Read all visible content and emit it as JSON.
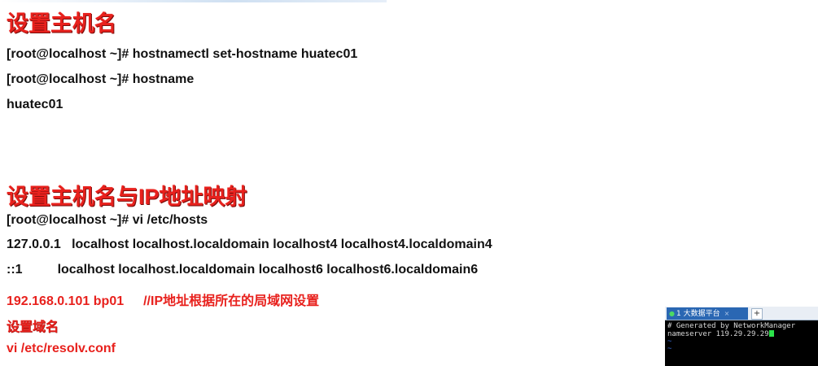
{
  "section1": {
    "heading": "设置主机名",
    "lines": [
      "[root@localhost ~]# hostnamectl set-hostname huatec01",
      "[root@localhost ~]# hostname",
      "huatec01"
    ]
  },
  "section2": {
    "heading": "设置主机名与IP地址映射",
    "cmd": "[root@localhost ~]# vi /etc/hosts",
    "hosts_line1": "127.0.0.1   localhost localhost.localdomain localhost4 localhost4.localdomain4",
    "hosts_line2_prefix": "::1",
    "hosts_line2_rest": "localhost localhost.localdomain localhost6 localhost6.localdomain6",
    "mapping_entry": "192.168.0.101 bp01",
    "mapping_comment": "//IP地址根据所在的局域网设置",
    "subheading": "设置域名",
    "resolv_cmd": "vi /etc/resolv.conf"
  },
  "terminal": {
    "tab_label": "1 大数据平台",
    "tab_close": "×",
    "new_tab": "+",
    "line1": "# Generated by NetworkManager",
    "line2": "nameserver 119.29.29.29",
    "tilde": "~"
  },
  "colors": {
    "heading": "#e8211d",
    "text": "#111111",
    "terminal_bg": "#000000",
    "cursor": "#2be34a",
    "tab_active": "#2a67b3"
  }
}
